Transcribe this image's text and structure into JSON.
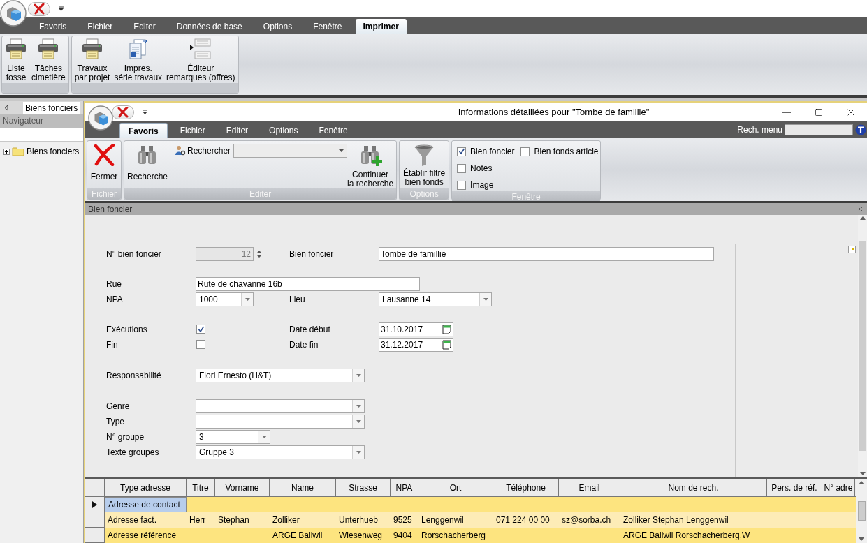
{
  "app_tabs": [
    {
      "label": "Favoris",
      "selected": false
    },
    {
      "label": "Fichier",
      "selected": false
    },
    {
      "label": "Editer",
      "selected": false
    },
    {
      "label": "Données de base",
      "selected": false
    },
    {
      "label": "Options",
      "selected": false
    },
    {
      "label": "Fenêtre",
      "selected": false
    },
    {
      "label": "Imprimer",
      "selected": true
    }
  ],
  "app_ribbon_groups": [
    {
      "buttons": [
        {
          "label": "Liste\nfosse"
        },
        {
          "label": "Tâches\ncimetière"
        }
      ]
    },
    {
      "buttons": [
        {
          "label": "Travaux\npar projet"
        },
        {
          "label": "Impres.\nsérie travaux"
        },
        {
          "label": "Éditeur\nremarques (offres)"
        }
      ]
    }
  ],
  "navigator": {
    "tab": "Biens fonciers",
    "title": "Navigateur",
    "tree": [
      {
        "label": "Biens fonciers",
        "expanded": false
      }
    ]
  },
  "detail_window": {
    "title": "Informations détaillées pour \"Tombe de famillie\"",
    "tabs": [
      {
        "label": "Favoris",
        "selected": true
      },
      {
        "label": "Fichier",
        "selected": false
      },
      {
        "label": "Editer",
        "selected": false
      },
      {
        "label": "Options",
        "selected": false
      },
      {
        "label": "Fenêtre",
        "selected": false
      }
    ],
    "menu_search_label": "Rech. menu",
    "ribbon": {
      "fichier": {
        "label": "Fichier",
        "close_button": "Fermer"
      },
      "editer": {
        "label": "Editer",
        "search_button": "Recherche",
        "search_field_label": "Rechercher",
        "continue_button": "Continuer\nla recherche"
      },
      "options": {
        "label": "Options",
        "filter_button": "Établir filtre\nbien fonds"
      },
      "fenetre": {
        "label": "Fenêtre",
        "checkboxes": [
          {
            "label": "Bien foncier",
            "checked": true
          },
          {
            "label": "Bien fonds article",
            "checked": false
          },
          {
            "label": "Notes",
            "checked": false
          },
          {
            "label": "Image",
            "checked": false
          }
        ]
      }
    }
  },
  "panel": {
    "title": "Bien foncier"
  },
  "form": {
    "no_bien_foncier": {
      "label": "N° bien foncier",
      "value": "12",
      "disabled": true
    },
    "bien_foncier": {
      "label": "Bien foncier",
      "value": "Tombe de famillie"
    },
    "rue": {
      "label": "Rue",
      "value": "Rute de chavanne 16b"
    },
    "npa": {
      "label": "NPA",
      "value": "1000"
    },
    "lieu": {
      "label": "Lieu",
      "value": "Lausanne 14"
    },
    "executions": {
      "label": "Exécutions",
      "checked": true
    },
    "fin": {
      "label": "Fin",
      "checked": false
    },
    "date_debut": {
      "label": "Date début",
      "value": "31.10.2017"
    },
    "date_fin": {
      "label": "Date fin",
      "value": "31.12.2017"
    },
    "responsabilite": {
      "label": "Responsabilité",
      "value": "Fiori Ernesto (H&T)"
    },
    "genre": {
      "label": "Genre"
    },
    "type": {
      "label": "Type"
    },
    "no_groupe": {
      "label": "N° groupe",
      "value": "3"
    },
    "texte_groupes": {
      "label": "Texte groupes",
      "value": "Gruppe 3"
    }
  },
  "address_grid": {
    "columns": [
      "Type adresse",
      "Titre",
      "Vorname",
      "Name",
      "Strasse",
      "NPA",
      "Ort",
      "Téléphone",
      "Email",
      "Nom de rech.",
      "Pers. de réf.",
      "N° adre"
    ],
    "rows": [
      {
        "selected": true,
        "cells": [
          "Adresse de contact",
          null,
          null,
          null,
          null,
          null,
          null,
          null,
          null,
          null,
          null,
          null
        ]
      },
      {
        "selected": false,
        "cells": [
          "Adresse fact.",
          "Herr",
          "Stephan",
          "Zolliker",
          "Unterhueb",
          "9525",
          "Lenggenwil",
          "071 224 00 00",
          "sz@sorba.ch",
          "Zolliker Stephan Lenggenwil",
          null,
          null
        ]
      },
      {
        "selected": false,
        "cells": [
          "Adresse référence",
          null,
          null,
          "ARGE Ballwil",
          "Wiesenweg",
          "9404",
          "Rorschacherberg",
          null,
          null,
          "ARGE Ballwil Rorschacherberg,W",
          null,
          null
        ]
      }
    ]
  }
}
